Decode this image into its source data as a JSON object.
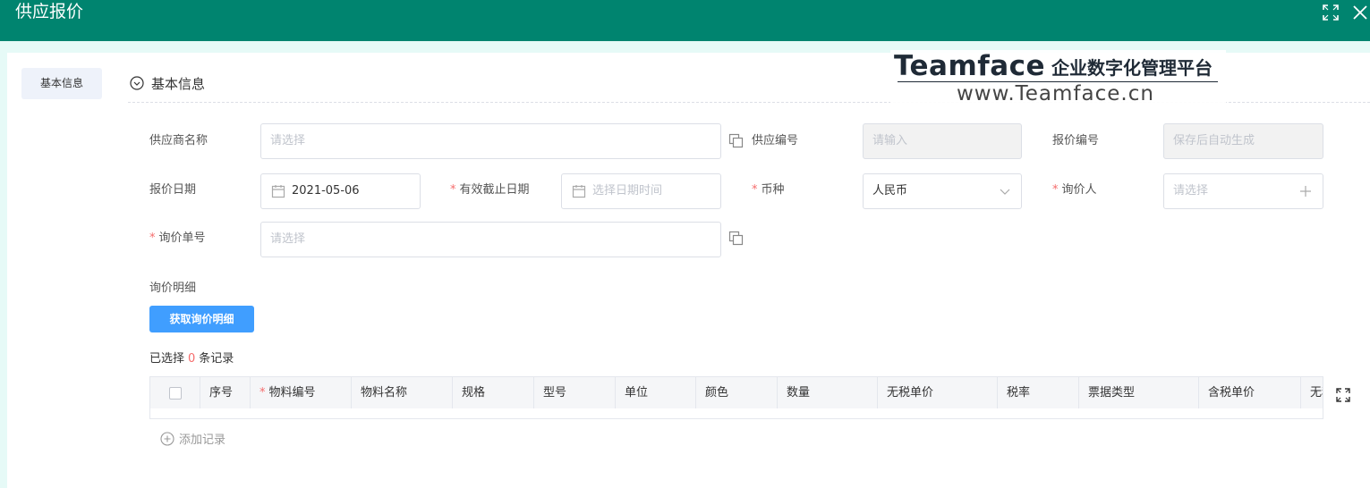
{
  "header": {
    "title": "供应报价",
    "fullscreen_icon": "fullscreen-icon",
    "close_icon": "close-icon"
  },
  "sidebar": {
    "tab_label": "基本信息"
  },
  "section": {
    "title": "基本信息"
  },
  "watermark": {
    "brand": "Teamface",
    "dot": "·",
    "slogan": "企业数字化管理平台",
    "url": "www.Teamface.cn"
  },
  "form": {
    "supplier_name": {
      "label": "供应商名称",
      "placeholder": "请选择"
    },
    "supplier_code": {
      "label": "供应编号",
      "placeholder": "请输入"
    },
    "quote_code": {
      "label": "报价编号",
      "placeholder": "保存后自动生成"
    },
    "quote_date": {
      "label": "报价日期",
      "value": "2021-05-06"
    },
    "valid_until": {
      "label": "有效截止日期",
      "placeholder": "选择日期时间",
      "required": "*"
    },
    "currency": {
      "label": "币种",
      "value": "人民币",
      "required": "*"
    },
    "inquirer": {
      "label": "询价人",
      "placeholder": "请选择",
      "required": "*"
    },
    "inquiry_no": {
      "label": "询价单号",
      "placeholder": "请选择",
      "required": "*"
    }
  },
  "details": {
    "label": "询价明细",
    "fetch_button": "获取询价明细",
    "selected_prefix": "已选择",
    "selected_count": "0",
    "selected_suffix": "条记录",
    "columns": [
      "序号",
      "物料编号",
      "物料名称",
      "规格",
      "型号",
      "单位",
      "颜色",
      "数量",
      "无税单价",
      "税率",
      "票据类型",
      "含税单价",
      "无税"
    ],
    "required_mark": "*",
    "add_record": "添加记录"
  }
}
